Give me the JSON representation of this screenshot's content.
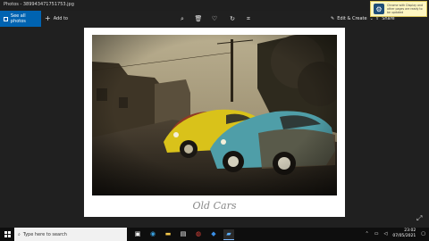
{
  "window": {
    "title": "Photos - 389943471751753.jpg"
  },
  "toolbar": {
    "see_all_label": "See all photos",
    "add_label": "Add to",
    "edit_create_label": "Edit & Create",
    "share_label": "Share"
  },
  "notification": {
    "text": "Chrome with Display and other pages are ready to be updated",
    "icon": "gear-icon"
  },
  "photo": {
    "caption": "Old Cars"
  },
  "taskbar": {
    "search_placeholder": "Type here to search",
    "time": "23:02",
    "date": "07/05/2021"
  },
  "colors": {
    "accent": "#0063b1",
    "bg": "#202020",
    "taskbar": "#0e0e0e"
  }
}
